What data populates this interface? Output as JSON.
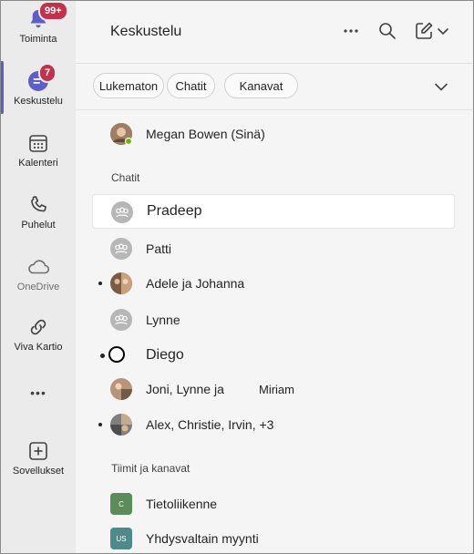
{
  "rail": {
    "activity": {
      "label": "Toiminta",
      "badge": "99+"
    },
    "chat": {
      "label": "Keskustelu",
      "badge": "7"
    },
    "calendar": {
      "label": "Kalenteri"
    },
    "calls": {
      "label": "Puhelut"
    },
    "onedrive": {
      "label": "OneDrive"
    },
    "viva": {
      "label": "Viva Kartio"
    },
    "more": {
      "label": "•••"
    },
    "apps": {
      "label": "Sovellukset"
    }
  },
  "header": {
    "title": "Keskustelu"
  },
  "filters": [
    "Lukematon",
    "Chatit",
    "Kanavat"
  ],
  "me": {
    "name": "Megan Bowen (Sinä)"
  },
  "sections": {
    "chats": "Chatit",
    "teams": "Tiimit ja kanavat"
  },
  "chats": [
    {
      "name": "Pradeep"
    },
    {
      "name": "Patti"
    },
    {
      "name": "Adele ja Johanna"
    },
    {
      "name": "Lynne"
    },
    {
      "name": "Diego"
    },
    {
      "name": "Joni, Lynne ja",
      "extra": "Miriam"
    },
    {
      "name": "Alex, Christie, Irvin, +3"
    }
  ],
  "teams": [
    {
      "name": "Tietoliikenne",
      "initials": "C",
      "color": "#5b8c5a"
    },
    {
      "name": "Yhdysvaltain myynti",
      "initials": "US",
      "color": "#4f8a8b"
    }
  ],
  "colors": {
    "accent": "#5b5fc7",
    "badge": "#c4314b"
  }
}
